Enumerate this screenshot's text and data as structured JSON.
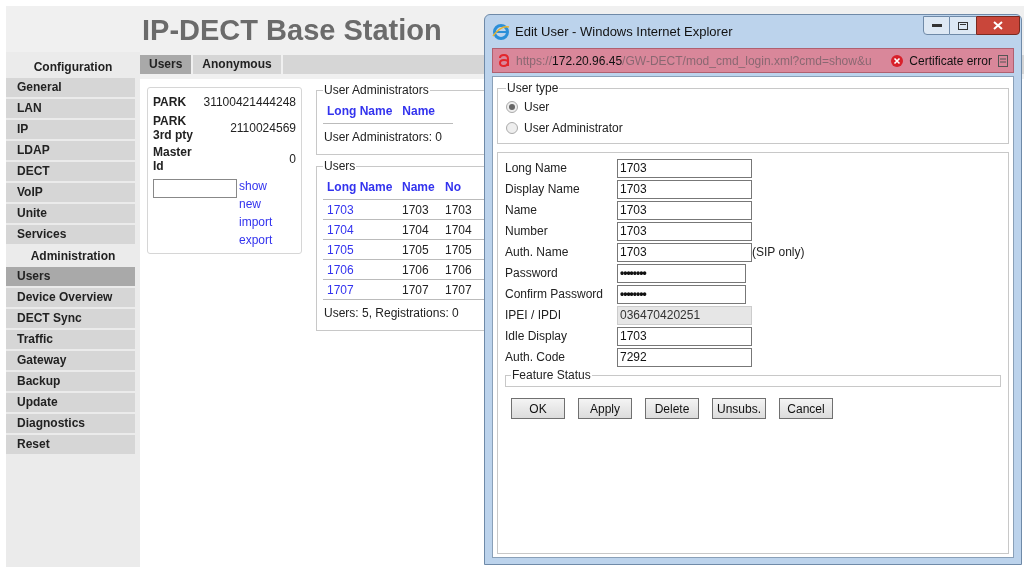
{
  "page_title": "IP-DECT Base Station",
  "sidebar": {
    "sections": [
      {
        "title": "Configuration",
        "items": [
          {
            "label": "General",
            "selected": false
          },
          {
            "label": "LAN",
            "selected": false
          },
          {
            "label": "IP",
            "selected": false
          },
          {
            "label": "LDAP",
            "selected": false
          },
          {
            "label": "DECT",
            "selected": false
          },
          {
            "label": "VoIP",
            "selected": false
          },
          {
            "label": "Unite",
            "selected": false
          },
          {
            "label": "Services",
            "selected": false
          }
        ]
      },
      {
        "title": "Administration",
        "items": [
          {
            "label": "Users",
            "selected": true
          },
          {
            "label": "Device Overview",
            "selected": false
          },
          {
            "label": "DECT Sync",
            "selected": false
          },
          {
            "label": "Traffic",
            "selected": false
          },
          {
            "label": "Gateway",
            "selected": false
          },
          {
            "label": "Backup",
            "selected": false
          },
          {
            "label": "Update",
            "selected": false
          },
          {
            "label": "Diagnostics",
            "selected": false
          },
          {
            "label": "Reset",
            "selected": false
          }
        ]
      }
    ]
  },
  "tabs": [
    {
      "label": "Users",
      "selected": true
    },
    {
      "label": "Anonymous",
      "selected": false
    }
  ],
  "park": {
    "rows": [
      {
        "label": "PARK",
        "value": "31100421444248"
      },
      {
        "label": "PARK 3rd pty",
        "value": "2110024569"
      },
      {
        "label": "Master Id",
        "value": "0"
      }
    ],
    "links": [
      "show",
      "new",
      "import",
      "export"
    ]
  },
  "user_administrators": {
    "legend": "User Administrators",
    "columns": [
      "Long Name",
      "Name"
    ],
    "summary": "User Administrators: 0"
  },
  "users": {
    "legend": "Users",
    "columns": [
      "Long Name",
      "Name",
      "No"
    ],
    "rows": [
      [
        "1703",
        "1703",
        "1703"
      ],
      [
        "1704",
        "1704",
        "1704"
      ],
      [
        "1705",
        "1705",
        "1705"
      ],
      [
        "1706",
        "1706",
        "1706"
      ],
      [
        "1707",
        "1707",
        "1707"
      ]
    ],
    "summary": "Users: 5, Registrations: 0"
  },
  "dialog": {
    "title": "Edit User - Windows Internet Explorer",
    "address": {
      "scheme": "https://",
      "host": "172.20.96.45",
      "path": "/GW-DECT/mod_cmd_login.xml?cmd=show&u",
      "warning": "Certificate error"
    },
    "user_type": {
      "legend": "User type",
      "options": [
        {
          "label": "User",
          "selected": true
        },
        {
          "label": "User Administrator",
          "selected": false
        }
      ]
    },
    "fields": [
      {
        "label": "Long Name",
        "value": "1703",
        "kind": "text"
      },
      {
        "label": "Display Name",
        "value": "1703",
        "kind": "text"
      },
      {
        "label": "Name",
        "value": "1703",
        "kind": "text"
      },
      {
        "label": "Number",
        "value": "1703",
        "kind": "text"
      },
      {
        "label": "Auth. Name",
        "value": "1703",
        "kind": "text",
        "note": "(SIP only)"
      },
      {
        "label": "Password",
        "value": "••••••••",
        "kind": "password"
      },
      {
        "label": "Confirm Password",
        "value": "••••••••",
        "kind": "password"
      },
      {
        "label": "IPEI / IPDI",
        "value": "036470420251",
        "kind": "readonly"
      },
      {
        "label": "Idle Display",
        "value": "1703",
        "kind": "text"
      },
      {
        "label": "Auth. Code",
        "value": "7292",
        "kind": "text"
      }
    ],
    "feature_status": {
      "legend": "Feature Status"
    },
    "buttons": [
      "OK",
      "Apply",
      "Delete",
      "Unsubs.",
      "Cancel"
    ]
  }
}
